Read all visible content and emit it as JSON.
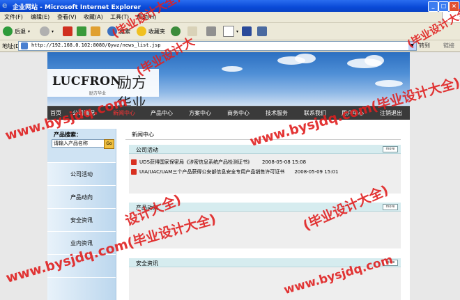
{
  "window": {
    "title": "企业网站 - Microsoft Internet Explorer",
    "min": "_",
    "max": "□",
    "close": "×"
  },
  "menu": [
    "文件(F)",
    "编辑(E)",
    "查看(V)",
    "收藏(A)",
    "工具(T)",
    "帮助(H)"
  ],
  "toolbar": {
    "back": "后退",
    "search": "搜索",
    "favorites": "收藏夹"
  },
  "address": {
    "label": "地址(D)",
    "url": "http://192.168.0.102:8080/Qywz/news_list.jsp",
    "go": "转到",
    "links": "链接"
  },
  "banner": {
    "logo_en": "LUCFRON",
    "logo_cn": "励方华业",
    "logo_sub": "励方华业"
  },
  "nav": [
    "首页",
    "公司情况",
    "新闻中心",
    "产品中心",
    "方案中心",
    "商务中心",
    "技术服务",
    "联系我们",
    "用户中心",
    "注销退出"
  ],
  "sidebar": {
    "search_label": "产品搜索：",
    "search_placeholder": "请输入产品名称",
    "search_go": "Go",
    "items": [
      "公司活动",
      "产品动向",
      "安全资讯",
      "业内资讯",
      "",
      ""
    ]
  },
  "main": {
    "breadcrumb": "新闻中心",
    "sections": [
      {
        "title": "公司活动",
        "more": "more",
        "news": [
          {
            "title": "UDS获得国家保密局《涉密信息系统产品检测证书》",
            "date": "2008-05-08 15:08"
          },
          {
            "title": "UIA/UAC/UAM三个产品获得公安部信息安全专用产品销售许可证书",
            "date": "2008-05-09 15:01"
          }
        ]
      },
      {
        "title": "产品动向",
        "more": "more",
        "news": []
      },
      {
        "title": "安全资讯",
        "more": "more",
        "news": []
      }
    ]
  },
  "watermark": "www.bysjdq.com(毕业设计大全)",
  "watermark_short": "www.bysjdq.com",
  "watermark_brand": "(毕业设计大全)",
  "watermark_frag": "(毕业设计大",
  "watermark_tail": "设计大全)"
}
